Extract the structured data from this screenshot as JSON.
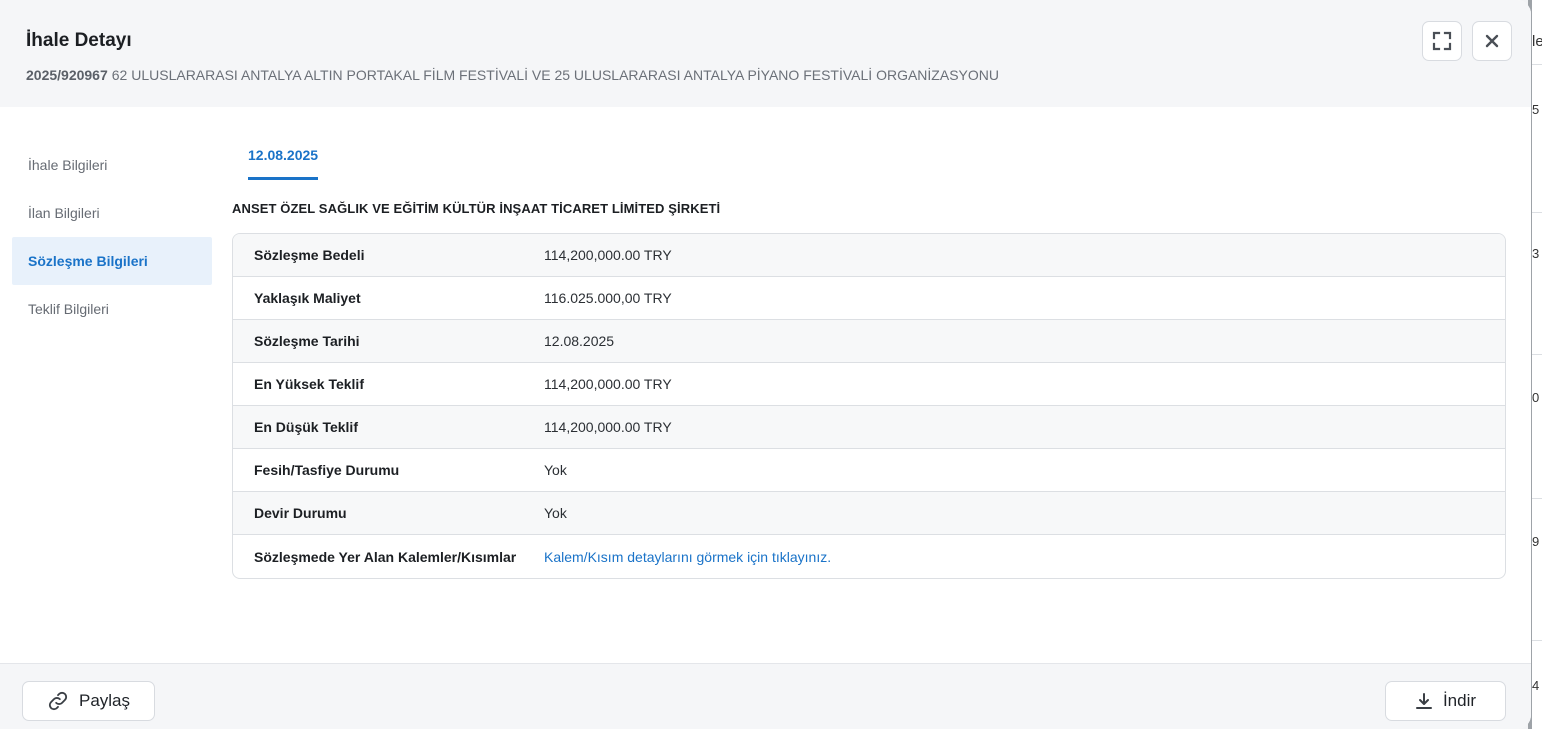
{
  "header": {
    "title": "İhale Detayı",
    "reference": "2025/920967",
    "subject": "62 ULUSLARARASI ANTALYA ALTIN PORTAKAL FİLM FESTİVALİ VE 25 ULUSLARARASI ANTALYA PİYANO FESTİVALİ ORGANİZASYONU",
    "expand_icon": "expand-icon",
    "close_icon": "close-icon"
  },
  "sidebar": {
    "items": [
      {
        "label": "İhale Bilgileri",
        "active": false
      },
      {
        "label": "İlan Bilgileri",
        "active": false
      },
      {
        "label": "Sözleşme Bilgileri",
        "active": true
      },
      {
        "label": "Teklif Bilgileri",
        "active": false
      }
    ]
  },
  "content": {
    "tabs": [
      {
        "label": "12.08.2025"
      }
    ],
    "company": "ANSET ÖZEL SAĞLIK VE EĞİTİM KÜLTÜR İNŞAAT TİCARET LİMİTED ŞİRKETİ",
    "rows": [
      {
        "key": "Sözleşme Bedeli",
        "value": "114,200,000.00 TRY"
      },
      {
        "key": "Yaklaşık Maliyet",
        "value": "116.025.000,00 TRY"
      },
      {
        "key": "Sözleşme Tarihi",
        "value": "12.08.2025"
      },
      {
        "key": "En Yüksek Teklif",
        "value": "114,200,000.00 TRY"
      },
      {
        "key": "En Düşük Teklif",
        "value": "114,200,000.00 TRY"
      },
      {
        "key": "Fesih/Tasfiye Durumu",
        "value": "Yok"
      },
      {
        "key": "Devir Durumu",
        "value": "Yok"
      },
      {
        "key": "Sözleşmede Yer Alan Kalemler/Kısımlar",
        "value": "Kalem/Kısım detaylarını görmek için tıklayınız.",
        "link": true
      }
    ]
  },
  "footer": {
    "share_label": "Paylaş",
    "share_icon": "link-icon",
    "download_label": "İndir",
    "download_icon": "download-icon"
  },
  "background": {
    "edge_chars": [
      "le",
      "5",
      "3",
      "0",
      "9",
      "4"
    ]
  },
  "colors": {
    "accent": "#1a73c8",
    "active_bg": "#e8f1fb",
    "header_bg": "#f5f6f8"
  }
}
